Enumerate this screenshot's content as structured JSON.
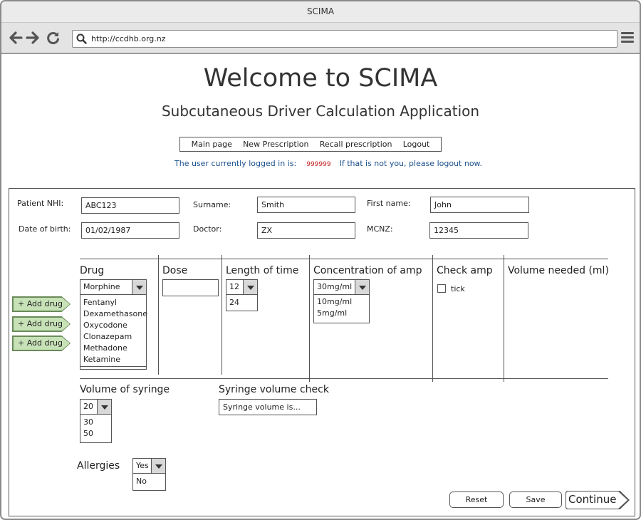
{
  "browser": {
    "title": "SCIMA",
    "url": "http://ccdhb.org.nz"
  },
  "header": {
    "title": "Welcome to SCIMA",
    "subtitle": "Subcutaneous Driver Calculation Application"
  },
  "nav": [
    "Main page",
    "New Prescription",
    "Recall prescription",
    "Logout"
  ],
  "login": {
    "prefix": "The user currently logged in is:",
    "user_id": "999999",
    "suffix": "If that is not you, please logout now."
  },
  "patient": {
    "nhi_label": "Patient NHI:",
    "nhi_value": "ABC123",
    "surname_label": "Surname:",
    "surname_value": "Smith",
    "firstname_label": "First name:",
    "firstname_value": "John",
    "dob_label": "Date of birth:",
    "dob_value": "01/02/1987",
    "doctor_label": "Doctor:",
    "doctor_value": "ZX",
    "mcnz_label": "MCNZ:",
    "mcnz_value": "12345"
  },
  "columns": {
    "drug": "Drug",
    "dose": "Dose",
    "length": "Length of time",
    "concentration": "Concentration of amp",
    "check_amp": "Check amp",
    "volume_needed": "Volume needed (ml)"
  },
  "drug": {
    "selected": "Morphine",
    "options": [
      "Fentanyl",
      "Dexamethasone",
      "Oxycodone",
      "Clonazepam",
      "Methadone",
      "Ketamine"
    ]
  },
  "length": {
    "selected": "12",
    "options": [
      "24"
    ]
  },
  "concentration": {
    "selected": "30mg/ml",
    "options": [
      "10mg/ml",
      "5mg/ml"
    ]
  },
  "check_amp": {
    "label": "tick"
  },
  "add_drug_label": "+ Add drug",
  "syringe": {
    "volume_label": "Volume of syringe",
    "selected": "20",
    "options": [
      "30",
      "50"
    ],
    "check_label": "Syringe volume check",
    "check_value": "Syringe volume is..."
  },
  "allergies": {
    "label": "Allergies",
    "selected": "Yes",
    "options": [
      "No"
    ]
  },
  "buttons": {
    "reset": "Reset",
    "save": "Save",
    "continue": "Continue"
  }
}
